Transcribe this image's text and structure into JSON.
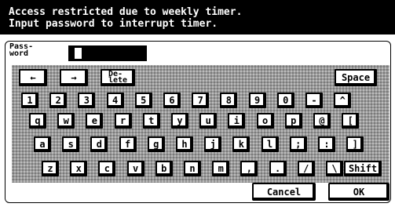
{
  "message": {
    "line1": "Access restricted due to weekly timer.",
    "line2": "Input password to interrupt timer."
  },
  "password": {
    "label": "Pass-\nword",
    "value": ""
  },
  "keyboard": {
    "controls": {
      "left": "←",
      "right": "→",
      "delete": "De-\nlete",
      "space": "Space"
    },
    "row1": [
      "1",
      "2",
      "3",
      "4",
      "5",
      "6",
      "7",
      "8",
      "9",
      "0",
      "-",
      "^"
    ],
    "row2": [
      "q",
      "w",
      "e",
      "r",
      "t",
      "y",
      "u",
      "i",
      "o",
      "p",
      "@",
      "["
    ],
    "row3": [
      "a",
      "s",
      "d",
      "f",
      "g",
      "h",
      "j",
      "k",
      "l",
      ";",
      ":",
      "]"
    ],
    "row4": [
      "z",
      "x",
      "c",
      "v",
      "b",
      "n",
      "m",
      ",",
      ".",
      "/",
      "\\"
    ],
    "shift": "Shift"
  },
  "actions": {
    "cancel": "Cancel",
    "ok": "OK"
  }
}
